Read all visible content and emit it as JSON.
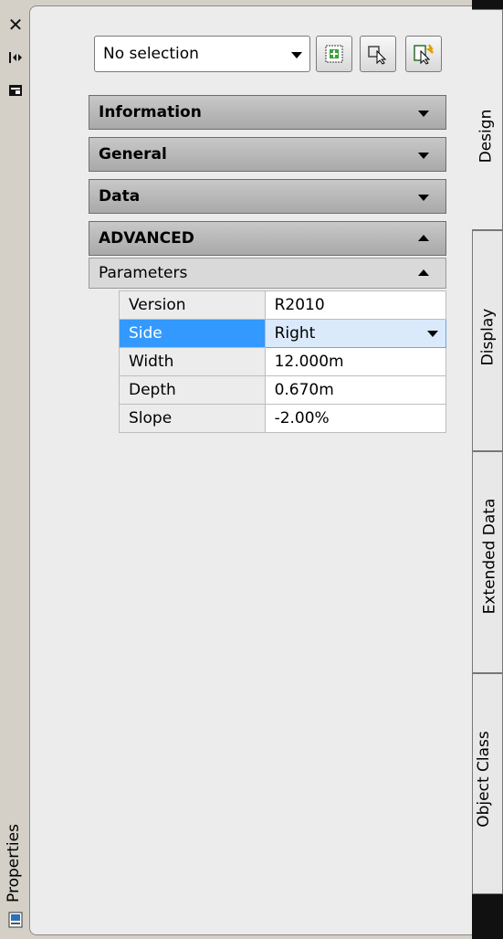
{
  "palette": {
    "title": "Properties"
  },
  "selection": {
    "value": "No selection"
  },
  "categories": [
    {
      "label": "Information"
    },
    {
      "label": "General"
    },
    {
      "label": "Data"
    },
    {
      "label": "ADVANCED"
    }
  ],
  "subcategory": {
    "label": "Parameters"
  },
  "properties": [
    {
      "key": "Version",
      "value": "R2010"
    },
    {
      "key": "Side",
      "value": "Right"
    },
    {
      "key": "Width",
      "value": "12.000m"
    },
    {
      "key": "Depth",
      "value": "0.670m"
    },
    {
      "key": "Slope",
      "value": "-2.00%"
    }
  ],
  "tabs": [
    {
      "label": "Design"
    },
    {
      "label": "Display"
    },
    {
      "label": "Extended Data"
    },
    {
      "label": "Object Class"
    }
  ],
  "colors": {
    "selection_highlight": "#3399ff",
    "header_gray": "#b0b0b0"
  }
}
